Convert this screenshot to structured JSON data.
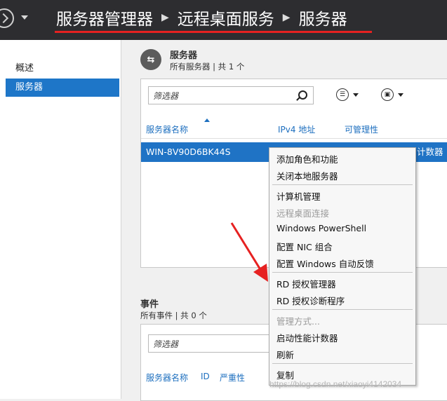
{
  "title": {
    "crumbs": [
      "服务器管理器",
      "远程桌面服务",
      "服务器"
    ]
  },
  "nav": {
    "items": [
      {
        "label": "概述"
      },
      {
        "label": "服务器"
      }
    ]
  },
  "servers": {
    "title": "服务器",
    "subtitle": "所有服务器 | 共 1 个",
    "filter_placeholder": "筛选器",
    "columns": [
      "服务器名称",
      "IPv4 地址",
      "可管理性"
    ],
    "row": {
      "name": "WIN-8V90D6BK44S",
      "trailing": "计数器"
    }
  },
  "events": {
    "title": "事件",
    "subtitle": "所有事件 | 共 0 个",
    "filter_placeholder": "筛选器",
    "columns": [
      "服务器名称",
      "ID",
      "严重性"
    ]
  },
  "context_menu": {
    "groups": [
      [
        "添加角色和功能",
        "关闭本地服务器"
      ],
      [
        "计算机管理",
        "远程桌面连接",
        "Windows PowerShell",
        "配置 NIC 组合",
        "配置 Windows 自动反馈"
      ],
      [
        "RD 授权管理器",
        "RD 授权诊断程序"
      ],
      [
        "管理方式...",
        "启动性能计数器",
        "刷新"
      ],
      [
        "复制"
      ]
    ],
    "disabled": [
      "远程桌面连接",
      "管理方式..."
    ]
  },
  "watermark": "https://blog.csdn.net/xiaoyi4142034",
  "colors": {
    "titlebar": "#2d2d30",
    "accent": "#1e76c8",
    "annotation": "#e62121"
  }
}
